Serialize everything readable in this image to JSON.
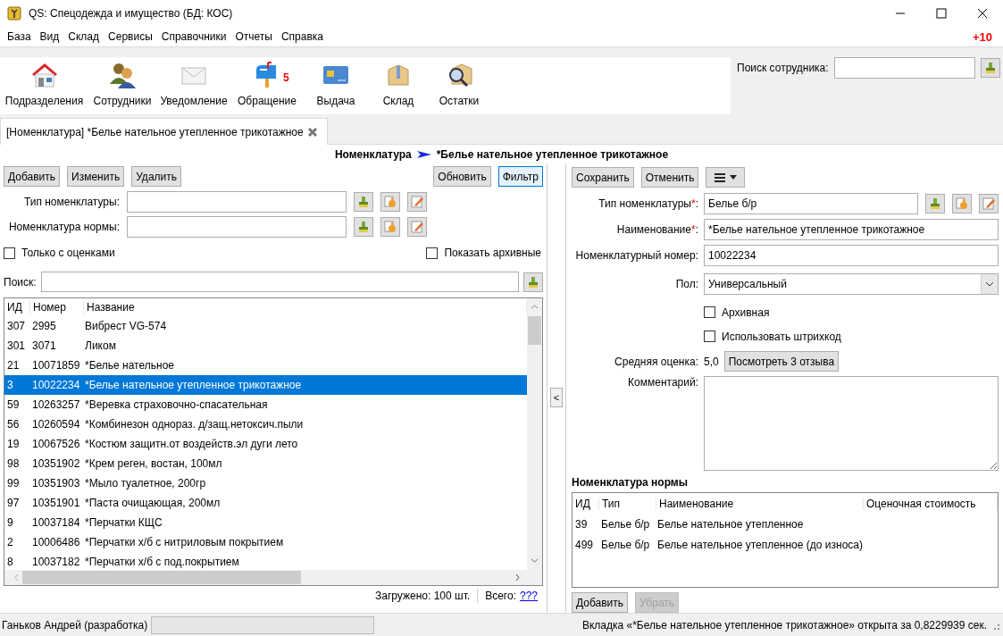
{
  "window": {
    "title": "QS: Спецодежда и имущество (БД: КОС)"
  },
  "menu": [
    "База",
    "Вид",
    "Склад",
    "Сервисы",
    "Справочники",
    "Отчеты",
    "Справка"
  ],
  "notice": "+10",
  "toolbar": [
    {
      "label": "Подразделения",
      "kind": "house"
    },
    {
      "label": "Сотрудники",
      "kind": "people"
    },
    {
      "label": "Уведомление",
      "kind": "envelope"
    },
    {
      "label": "Обращение",
      "kind": "mailbox",
      "badge": "5"
    },
    {
      "label": "Выдача",
      "kind": "card"
    },
    {
      "label": "Склад",
      "kind": "box"
    },
    {
      "label": "Остатки",
      "kind": "box-search"
    }
  ],
  "employee_search": {
    "label": "Поиск сотрудника:"
  },
  "tabs": [
    {
      "label": "[Номенклатура] *Белье нательное утепленное трикотажное",
      "selected": true
    }
  ],
  "breadcrumb": [
    "Номенклатура",
    "*Белье нательное утепленное трикотажное"
  ],
  "left": {
    "buttons": [
      "Добавить",
      "Изменить",
      "Удалить"
    ],
    "right_buttons": [
      {
        "label": "Обновить",
        "on": false
      },
      {
        "label": "Фильтр",
        "on": true
      }
    ],
    "filters": [
      {
        "label": "Тип номенклатуры:"
      },
      {
        "label": "Номенклатура нормы:"
      }
    ],
    "checkboxes": [
      {
        "label": "Только с оценками",
        "checked": false
      },
      {
        "label": "Показать архивные",
        "checked": false
      }
    ],
    "search": {
      "label": "Поиск:"
    },
    "table": {
      "columns": [
        "ИД",
        "Номер",
        "Название"
      ],
      "rows": [
        {
          "cells": [
            "307",
            "2995",
            "Вибрест VG-574"
          ],
          "selected": false
        },
        {
          "cells": [
            "301",
            "3071",
            "Ликом"
          ],
          "selected": false
        },
        {
          "cells": [
            "21",
            "10071859",
            "*Белье нательное"
          ],
          "selected": false
        },
        {
          "cells": [
            "3",
            "10022234",
            "*Белье нательное утепленное трикотажное"
          ],
          "selected": true
        },
        {
          "cells": [
            "59",
            "10263257",
            "*Веревка страховочно-спасательная"
          ],
          "selected": false
        },
        {
          "cells": [
            "56",
            "10260594",
            "*Комбинезон однораз. д/защ.нетоксич.пыли"
          ],
          "selected": false
        },
        {
          "cells": [
            "19",
            "10067526",
            "*Костюм защитн.от воздейств.эл дуги лето"
          ],
          "selected": false
        },
        {
          "cells": [
            "98",
            "10351902",
            "*Крем реген, востан, 100мл"
          ],
          "selected": false
        },
        {
          "cells": [
            "99",
            "10351903",
            "*Мыло туалетное, 200гр"
          ],
          "selected": false
        },
        {
          "cells": [
            "97",
            "10351901",
            "*Паста очищающая, 200мл"
          ],
          "selected": false
        },
        {
          "cells": [
            "9",
            "10037184",
            "*Перчатки КЩС"
          ],
          "selected": false
        },
        {
          "cells": [
            "2",
            "10006486",
            "*Перчатки х/б с нитриловым покрытием"
          ],
          "selected": false
        },
        {
          "cells": [
            "8",
            "10037182",
            "*Перчатки х/б с под.покрытием"
          ],
          "selected": false
        }
      ]
    },
    "loaded": "Загружено: 100 шт.",
    "total_label": "Всего:",
    "total_link": "???"
  },
  "collapse_button": "<",
  "right": {
    "buttons": [
      "Сохранить",
      "Отменить"
    ],
    "fields": [
      {
        "kind": "lookup",
        "label": "Тип номенклатуры",
        "required_mark": "*",
        "label_end": ":",
        "value": "Белье б/р"
      },
      {
        "kind": "text",
        "label": "Наименование",
        "required_mark": "*",
        "label_end": ":",
        "value": "*Белье нательное утепленное трикотажное"
      },
      {
        "kind": "text",
        "label": "Номенклатурный номер:",
        "value": "10022234"
      },
      {
        "kind": "combo",
        "label": "Пол:",
        "value": "Универсальный"
      },
      {
        "kind": "checkbox",
        "label": "Архивная",
        "checked": false
      },
      {
        "kind": "checkbox",
        "label": "Использовать штрихкод",
        "checked": false
      },
      {
        "kind": "rating",
        "label": "Средняя оценка:",
        "value": "5,0",
        "button": "Посмотреть 3 отзыва"
      },
      {
        "kind": "memo",
        "label": "Комментарий:"
      }
    ],
    "norm": {
      "title": "Номенклатура нормы",
      "columns": [
        "ИД",
        "Тип",
        "Наименование",
        "Оценочная стоимость"
      ],
      "rows": [
        [
          "39",
          "Белье б/р",
          "Белье нательное утепленное"
        ],
        [
          "499",
          "Белье б/р",
          "Белье нательное утепленное (до износа)"
        ]
      ],
      "buttons": [
        {
          "label": "Добавить",
          "disabled": false
        },
        {
          "label": "Убрать",
          "disabled": true
        }
      ]
    }
  },
  "status": {
    "user": "Ганьков Андрей (разработка)",
    "message": "Вкладка «*Белье нательное утепленное трикотажное» открыта за 0,8229939 сек."
  }
}
